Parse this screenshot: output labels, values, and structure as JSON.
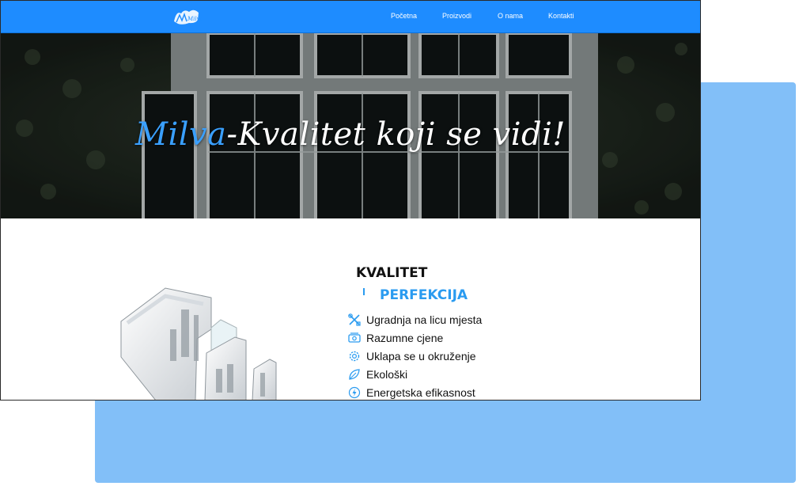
{
  "nav": {
    "logo_text": "Milva",
    "items": [
      {
        "label": "Početna"
      },
      {
        "label": "Proizvodi"
      },
      {
        "label": "O nama"
      },
      {
        "label": "Kontakti"
      }
    ]
  },
  "hero": {
    "title_accent": "Milva",
    "title_rest": "-Kvalitet koji se vidi!"
  },
  "section": {
    "heading1": "KVALITET",
    "heading2": "PERFEKCIJA",
    "features": [
      {
        "icon": "tools-icon",
        "label": "Ugradnja na licu mjesta"
      },
      {
        "icon": "money-icon",
        "label": "Razumne cjene"
      },
      {
        "icon": "gear-icon",
        "label": "Uklapa se u okruženje"
      },
      {
        "icon": "leaf-icon",
        "label": "Ekološki"
      },
      {
        "icon": "energy-icon",
        "label": "Energetska efikasnost"
      }
    ]
  },
  "colors": {
    "nav_bg": "#1e8cff",
    "accent": "#2a9bf0",
    "backdrop": "#82bff8"
  }
}
